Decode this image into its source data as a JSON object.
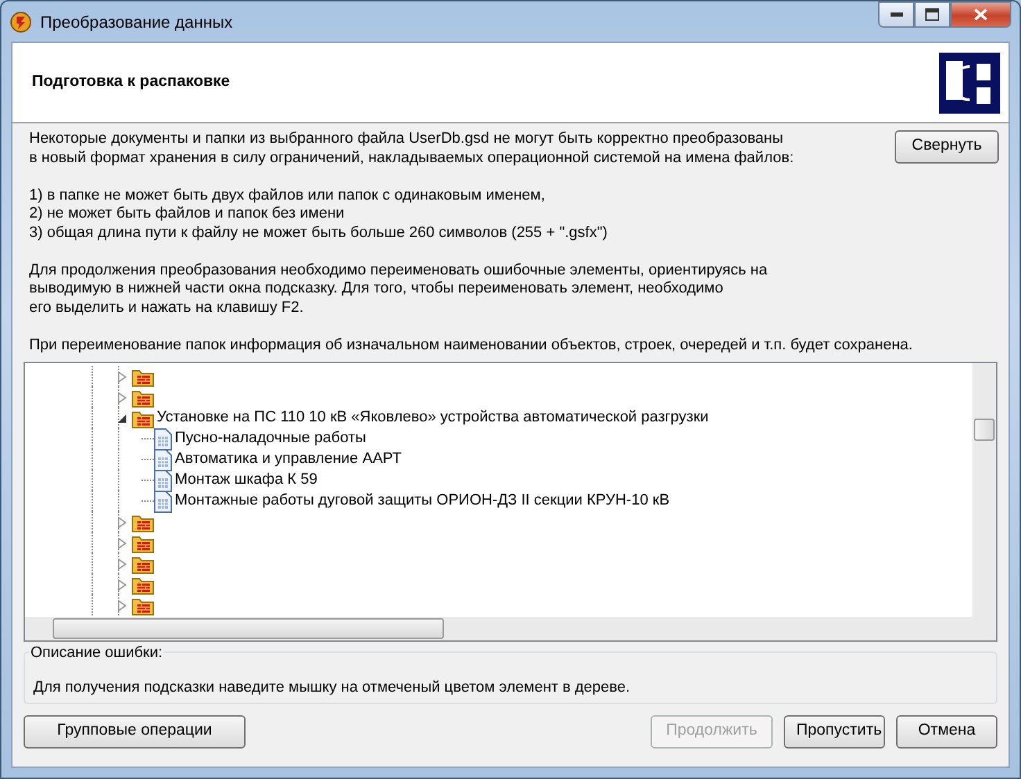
{
  "window": {
    "title": "Преобразование данных"
  },
  "header": {
    "title": "Подготовка к распаковке"
  },
  "info": {
    "paragraphs": [
      [
        "Некоторые документы и папки из выбранного файла UserDb.gsd не могут быть корректно преобразованы",
        "в новый формат хранения в силу ограничений, накладываемых операционной системой на имена файлов:"
      ],
      [
        "1) в папке не может быть двух файлов или папок с одинаковым именем,",
        "2) не может быть файлов и папок без имени",
        "3) общая длина пути к файлу не может быть больше 260 символов (255 + \".gsfx\")"
      ],
      [
        "Для продолжения преобразования необходимо переименовать ошибочные элементы, ориентируясь на",
        "выводимую в нижней части окна подсказку. Для того, чтобы переименовать элемент, необходимо",
        "его выделить и нажать на клавишу F2."
      ],
      [
        "При переименование папок информация об изначальном наименовании объектов, строек, очередей и т.п. будет сохранена."
      ]
    ],
    "collapse_button": "Свернуть"
  },
  "tree": [
    {
      "kind": "folder",
      "expanded": false
    },
    {
      "kind": "folder",
      "expanded": false
    },
    {
      "kind": "folder",
      "expanded": true,
      "label": "Установке на ПС 110 10 кВ «Яковлево» устройства автоматической разгрузки",
      "children": [
        {
          "kind": "document",
          "label": "Пусно-наладочные работы"
        },
        {
          "kind": "document",
          "label": "Автоматика и управление ААРТ"
        },
        {
          "kind": "document",
          "label": "Монтаж шкафа К 59"
        },
        {
          "kind": "document",
          "label": "Монтажные работы дуговой защиты ОРИОН-ДЗ II секции КРУН-10 кВ"
        }
      ]
    },
    {
      "kind": "folder",
      "expanded": false
    },
    {
      "kind": "folder",
      "expanded": false
    },
    {
      "kind": "folder",
      "expanded": false
    },
    {
      "kind": "folder",
      "expanded": false
    },
    {
      "kind": "folder",
      "expanded": false
    }
  ],
  "error_group": {
    "legend": "Описание ошибки:",
    "text": "Для получения подсказки наведите мышку на отмеченый цветом элемент в дереве."
  },
  "buttons": [
    {
      "label": "Групповые операции",
      "disabled": false
    },
    {
      "label": "Продолжить",
      "disabled": true
    },
    {
      "label": "Пропустить",
      "disabled": false
    },
    {
      "label": "Отмена",
      "disabled": false
    }
  ]
}
